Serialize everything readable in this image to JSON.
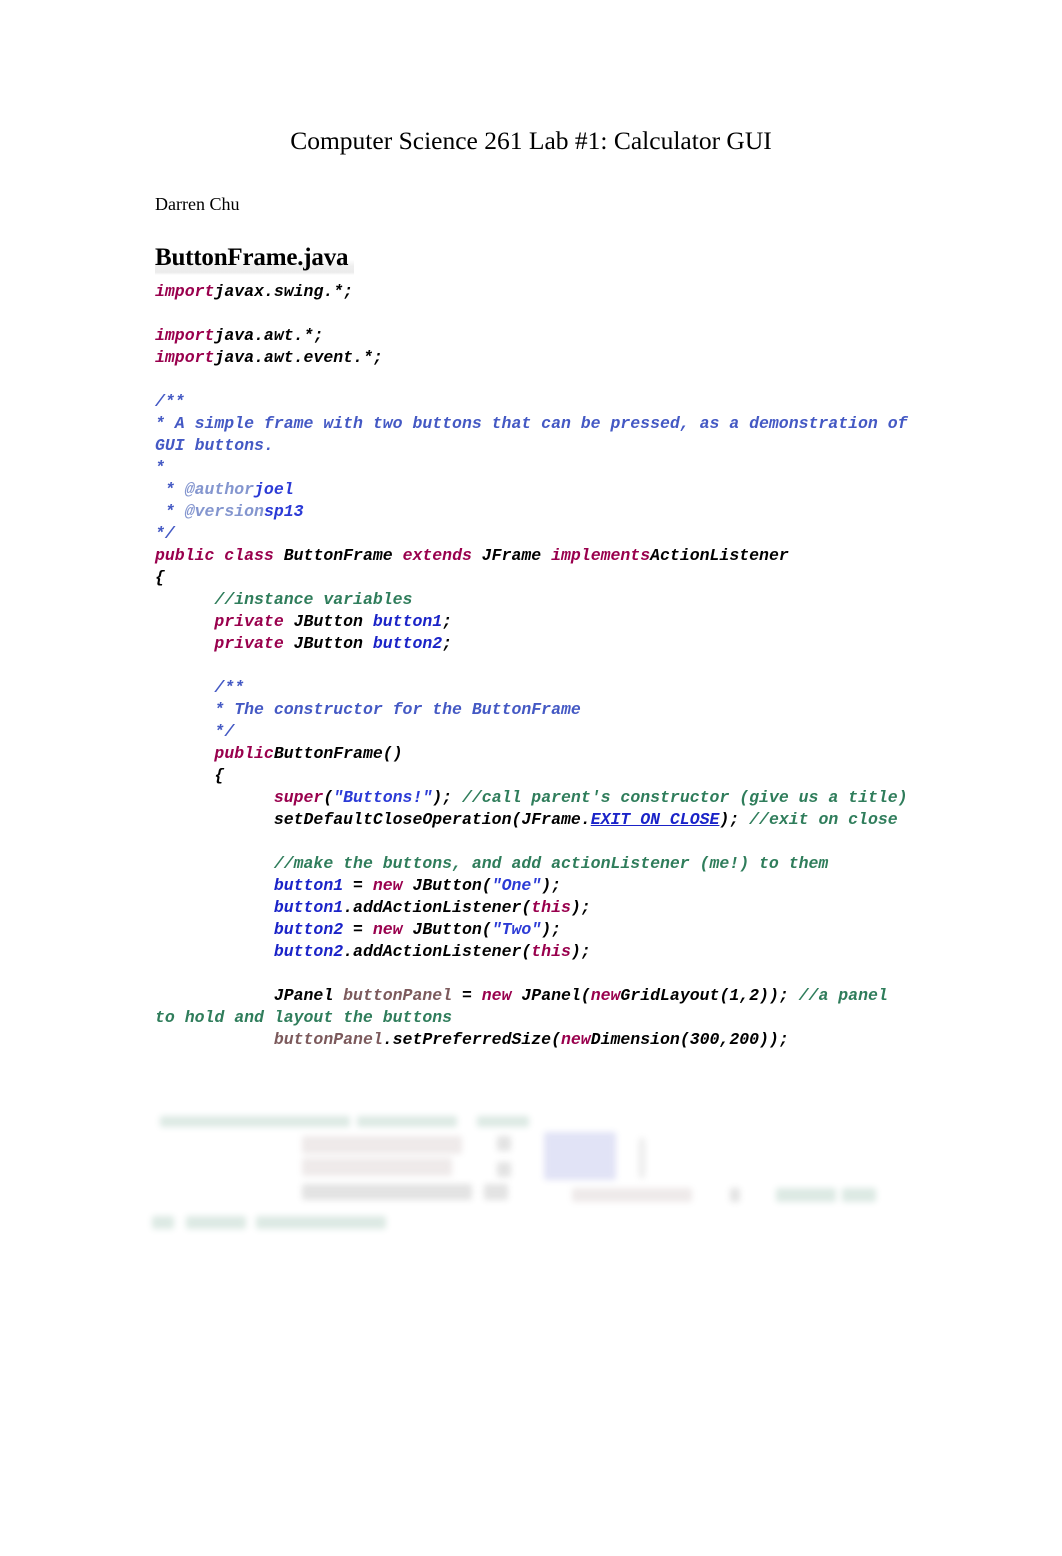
{
  "document": {
    "title": "Computer Science 261 Lab #1: Calculator GUI",
    "author": "Darren Chu",
    "file_heading": "ButtonFrame.java"
  },
  "colors": {
    "keyword": "#99004D",
    "type": "#000000",
    "field": "#1A23C8",
    "local": "#7C5A5C",
    "string": "#2B3AD6",
    "constant": "#1A23C8",
    "line_comment": "#2F7D5B",
    "javadoc": "#4459C4",
    "javadoc_tag": "#8496CF",
    "background": "#FFFFFF"
  },
  "code": {
    "language": "java",
    "lines": [
      {
        "tokens": [
          {
            "t": "import",
            "c": "kw"
          },
          {
            "t": "javax.swing.*;",
            "c": "type"
          }
        ]
      },
      {
        "tokens": []
      },
      {
        "tokens": [
          {
            "t": "import",
            "c": "kw"
          },
          {
            "t": "java.awt.*;",
            "c": "type"
          }
        ]
      },
      {
        "tokens": [
          {
            "t": "import",
            "c": "kw"
          },
          {
            "t": "java.awt.event.*;",
            "c": "type"
          }
        ]
      },
      {
        "tokens": []
      },
      {
        "tokens": [
          {
            "t": "/**",
            "c": "doc"
          }
        ]
      },
      {
        "tokens": [
          {
            "t": "* A simple frame with two buttons that can be pressed, as a demonstration of GUI buttons.",
            "c": "doc"
          }
        ]
      },
      {
        "tokens": [
          {
            "t": "*",
            "c": "doc"
          }
        ]
      },
      {
        "tokens": [
          {
            "t": " * ",
            "c": "doc"
          },
          {
            "t": "@author",
            "c": "tag"
          },
          {
            "t": "joel",
            "c": "tagval"
          }
        ]
      },
      {
        "tokens": [
          {
            "t": " * ",
            "c": "doc"
          },
          {
            "t": "@version",
            "c": "tag"
          },
          {
            "t": "sp13",
            "c": "tagval"
          }
        ]
      },
      {
        "tokens": [
          {
            "t": "*/",
            "c": "doc"
          }
        ]
      },
      {
        "tokens": [
          {
            "t": "public class ",
            "c": "kw"
          },
          {
            "t": "ButtonFrame ",
            "c": "type"
          },
          {
            "t": "extends ",
            "c": "kw"
          },
          {
            "t": "JFrame ",
            "c": "type"
          },
          {
            "t": "implements",
            "c": "kw"
          },
          {
            "t": "ActionListener",
            "c": "type"
          }
        ]
      },
      {
        "tokens": [
          {
            "t": "{",
            "c": "plain"
          }
        ]
      },
      {
        "tokens": [
          {
            "t": "      ",
            "c": "plain"
          },
          {
            "t": "//instance variables",
            "c": "cmt"
          }
        ]
      },
      {
        "tokens": [
          {
            "t": "      ",
            "c": "plain"
          },
          {
            "t": "private ",
            "c": "kw"
          },
          {
            "t": "JButton ",
            "c": "type"
          },
          {
            "t": "button1",
            "c": "field"
          },
          {
            "t": ";",
            "c": "plain"
          }
        ]
      },
      {
        "tokens": [
          {
            "t": "      ",
            "c": "plain"
          },
          {
            "t": "private ",
            "c": "kw"
          },
          {
            "t": "JButton ",
            "c": "type"
          },
          {
            "t": "button2",
            "c": "field"
          },
          {
            "t": ";",
            "c": "plain"
          }
        ]
      },
      {
        "tokens": []
      },
      {
        "tokens": [
          {
            "t": "      ",
            "c": "plain"
          },
          {
            "t": "/**",
            "c": "doc"
          }
        ]
      },
      {
        "tokens": [
          {
            "t": "      ",
            "c": "plain"
          },
          {
            "t": "* The constructor for the ButtonFrame",
            "c": "doc"
          }
        ]
      },
      {
        "tokens": [
          {
            "t": "      ",
            "c": "plain"
          },
          {
            "t": "*/",
            "c": "doc"
          }
        ]
      },
      {
        "tokens": [
          {
            "t": "      ",
            "c": "plain"
          },
          {
            "t": "public",
            "c": "kw"
          },
          {
            "t": "ButtonFrame()",
            "c": "type"
          }
        ]
      },
      {
        "tokens": [
          {
            "t": "      ",
            "c": "plain"
          },
          {
            "t": "{",
            "c": "plain"
          }
        ]
      },
      {
        "tokens": [
          {
            "t": "            ",
            "c": "plain"
          },
          {
            "t": "super",
            "c": "kw"
          },
          {
            "t": "(",
            "c": "plain"
          },
          {
            "t": "\"Buttons!\"",
            "c": "str"
          },
          {
            "t": "); ",
            "c": "plain"
          },
          {
            "t": "//call parent's constructor (give us a title)",
            "c": "cmt"
          }
        ]
      },
      {
        "tokens": [
          {
            "t": "            ",
            "c": "plain"
          },
          {
            "t": "setDefaultCloseOperation(JFrame.",
            "c": "type"
          },
          {
            "t": "EXIT_ON_CLOSE",
            "c": "const"
          },
          {
            "t": "); ",
            "c": "plain"
          },
          {
            "t": "//exit on close",
            "c": "cmt"
          }
        ]
      },
      {
        "tokens": []
      },
      {
        "tokens": [
          {
            "t": "            ",
            "c": "plain"
          },
          {
            "t": "//make the buttons, and add actionListener (me!) to them",
            "c": "cmt"
          }
        ]
      },
      {
        "tokens": [
          {
            "t": "            ",
            "c": "plain"
          },
          {
            "t": "button1",
            "c": "field"
          },
          {
            "t": " = ",
            "c": "plain"
          },
          {
            "t": "new ",
            "c": "kw"
          },
          {
            "t": "JButton(",
            "c": "type"
          },
          {
            "t": "\"One\"",
            "c": "str"
          },
          {
            "t": ");",
            "c": "plain"
          }
        ]
      },
      {
        "tokens": [
          {
            "t": "            ",
            "c": "plain"
          },
          {
            "t": "button1",
            "c": "field"
          },
          {
            "t": ".addActionListener(",
            "c": "type"
          },
          {
            "t": "this",
            "c": "kw"
          },
          {
            "t": ");",
            "c": "plain"
          }
        ]
      },
      {
        "tokens": [
          {
            "t": "            ",
            "c": "plain"
          },
          {
            "t": "button2",
            "c": "field"
          },
          {
            "t": " = ",
            "c": "plain"
          },
          {
            "t": "new ",
            "c": "kw"
          },
          {
            "t": "JButton(",
            "c": "type"
          },
          {
            "t": "\"Two\"",
            "c": "str"
          },
          {
            "t": ");",
            "c": "plain"
          }
        ]
      },
      {
        "tokens": [
          {
            "t": "            ",
            "c": "plain"
          },
          {
            "t": "button2",
            "c": "field"
          },
          {
            "t": ".addActionListener(",
            "c": "type"
          },
          {
            "t": "this",
            "c": "kw"
          },
          {
            "t": ");",
            "c": "plain"
          }
        ]
      },
      {
        "tokens": []
      },
      {
        "tokens": [
          {
            "t": "            ",
            "c": "plain"
          },
          {
            "t": "JPanel ",
            "c": "type"
          },
          {
            "t": "buttonPanel",
            "c": "local"
          },
          {
            "t": " = ",
            "c": "plain"
          },
          {
            "t": "new ",
            "c": "kw"
          },
          {
            "t": "JPanel(",
            "c": "type"
          },
          {
            "t": "new",
            "c": "kw"
          },
          {
            "t": "GridLayout(1,2));",
            "c": "type"
          },
          {
            "t": " ",
            "c": "plain"
          },
          {
            "t": "//a panel to hold and layout the buttons",
            "c": "cmt"
          }
        ]
      },
      {
        "tokens": [
          {
            "t": "            ",
            "c": "plain"
          },
          {
            "t": "buttonPanel",
            "c": "local"
          },
          {
            "t": ".setPreferredSize(",
            "c": "type"
          },
          {
            "t": "new",
            "c": "kw"
          },
          {
            "t": "Dimension(300,200));",
            "c": "type"
          }
        ]
      }
    ]
  },
  "faded_tail": {
    "description": "illegible faded and blurred remainder of the code listing",
    "legible": false
  }
}
